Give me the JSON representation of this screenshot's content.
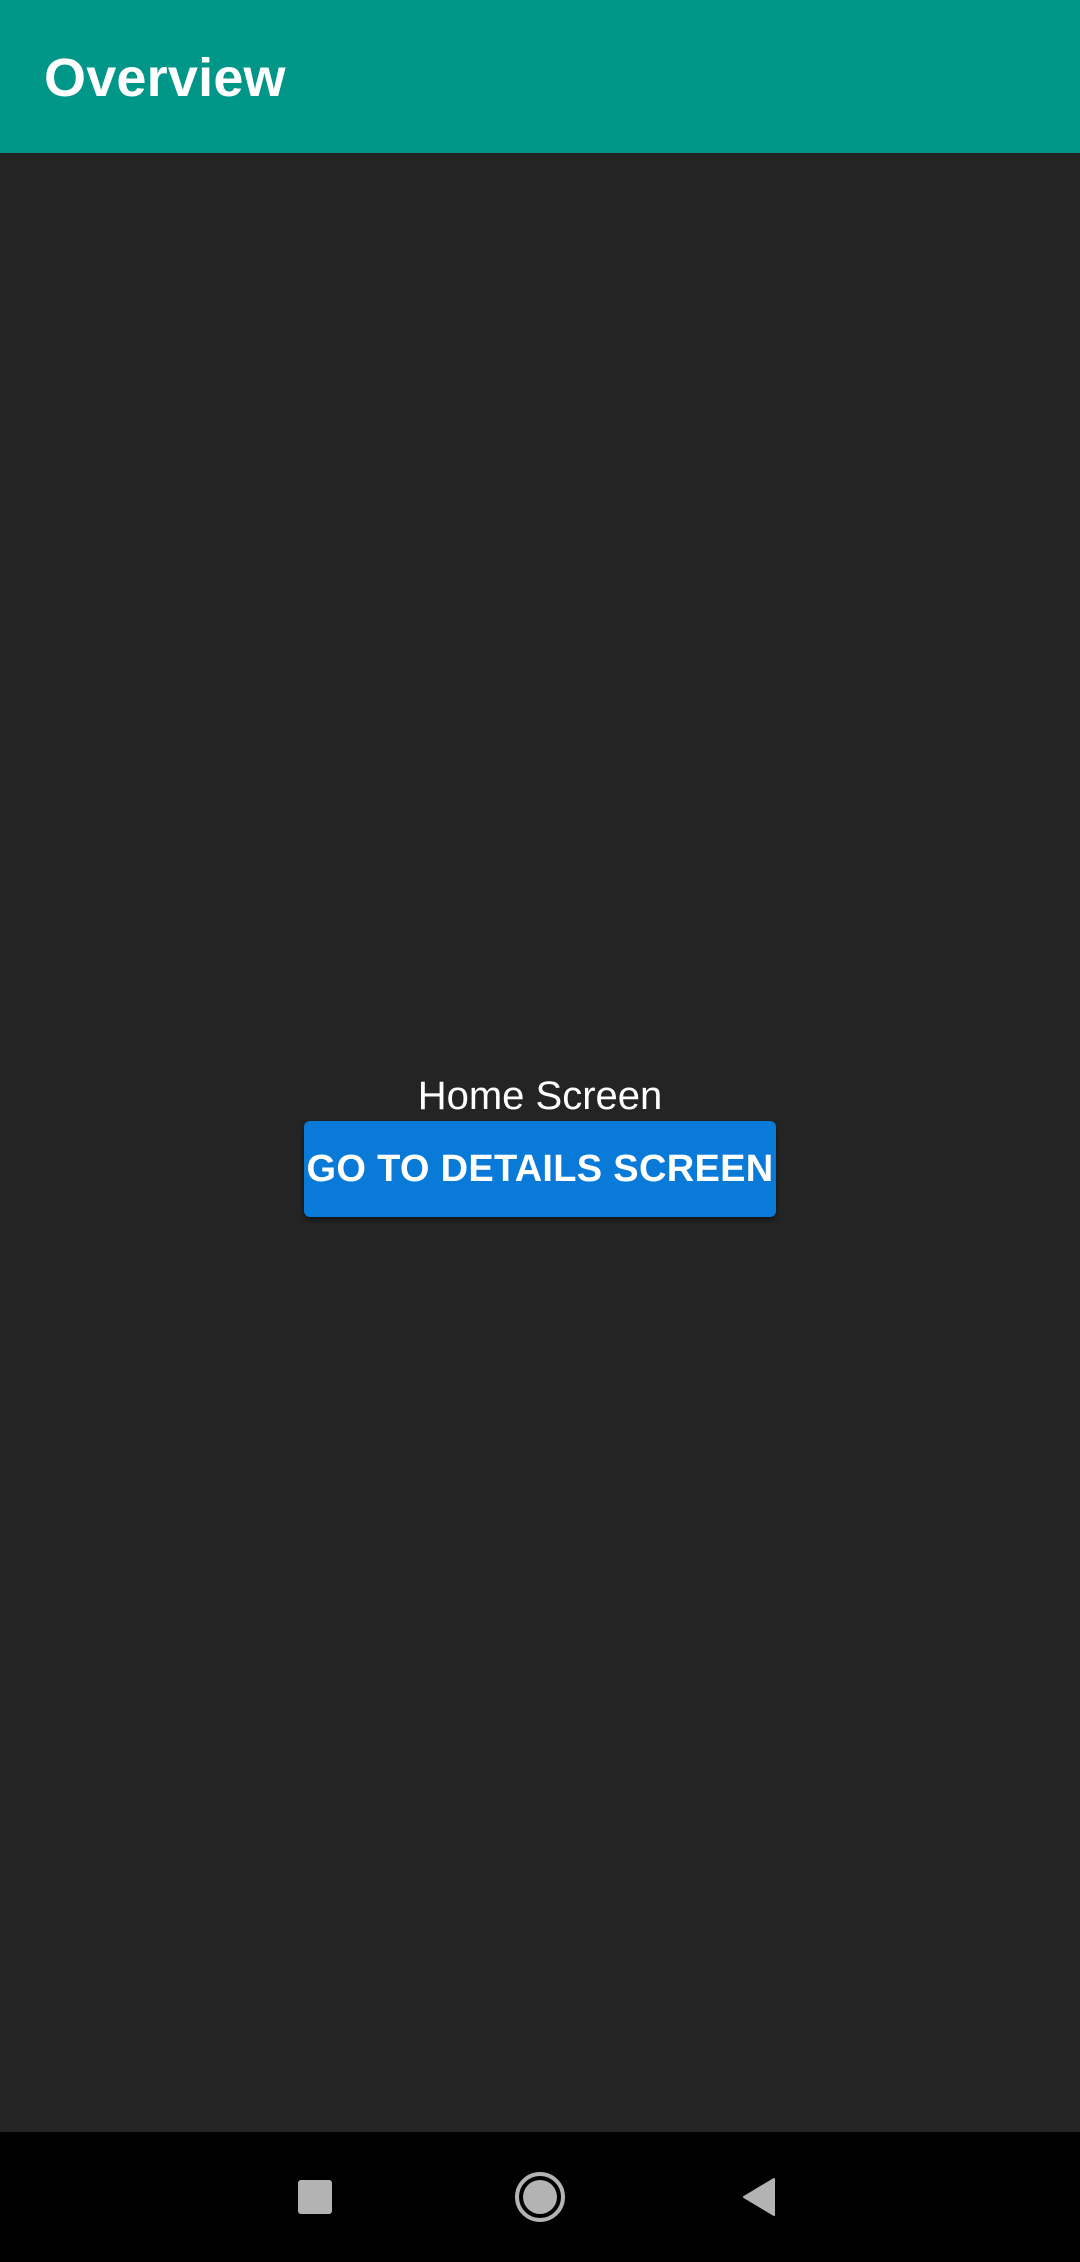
{
  "app_bar": {
    "title": "Overview",
    "background_color": "#009688"
  },
  "main": {
    "label": "Home Screen",
    "button_label": "GO TO DETAILS SCREEN",
    "button_color": "#0a7ad8",
    "background_color": "#242424"
  },
  "nav_bar": {
    "buttons": [
      {
        "icon": "square-recents-icon"
      },
      {
        "icon": "circle-home-icon"
      },
      {
        "icon": "triangle-back-icon"
      }
    ]
  }
}
